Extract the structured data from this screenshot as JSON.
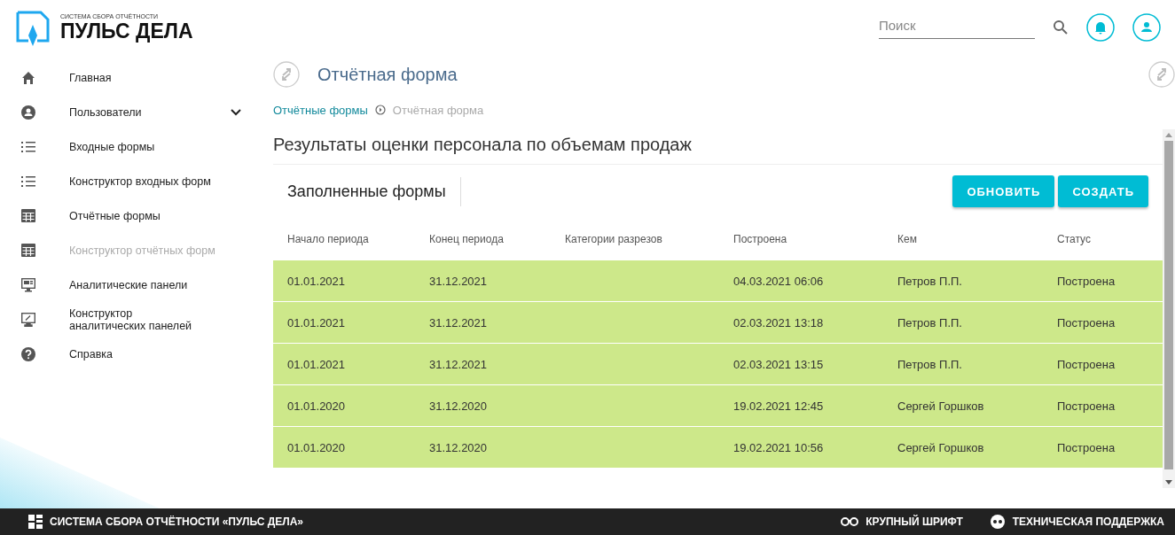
{
  "logo": {
    "subtitle": "СИСТЕМА СБОРА ОТЧЁТНОСТИ",
    "title": "ПУЛЬС ДЕЛА"
  },
  "search": {
    "placeholder": "Поиск"
  },
  "sidebar": {
    "items": [
      {
        "kind": "home",
        "label": "Главная",
        "disabled": false
      },
      {
        "kind": "user",
        "label": "Пользователи",
        "disabled": false,
        "expanded": false
      },
      {
        "kind": "list",
        "label": "Входные формы",
        "disabled": false
      },
      {
        "kind": "list",
        "label": "Конструктор входных форм",
        "disabled": false
      },
      {
        "kind": "table",
        "label": "Отчётные формы",
        "disabled": false
      },
      {
        "kind": "table",
        "label": "Конструктор отчётных форм",
        "disabled": true
      },
      {
        "kind": "monitor",
        "label": "Аналитические панели",
        "disabled": false
      },
      {
        "kind": "monitor-edit",
        "label": "Конструктор\nаналитических панелей",
        "disabled": false
      },
      {
        "kind": "help",
        "label": "Справка",
        "disabled": false
      }
    ]
  },
  "page_title": "Отчётная форма",
  "breadcrumbs": [
    "Отчётные формы",
    "Отчётная форма"
  ],
  "report_title": "Результаты оценки персонала по объемам продаж",
  "section_title": "Заполненные формы",
  "buttons": [
    "ОБНОВИТЬ",
    "СОЗДАТЬ"
  ],
  "table": {
    "columns": [
      "Начало периода",
      "Конец периода",
      "Категории разрезов",
      "Построена",
      "Кем",
      "Статус"
    ],
    "rows": [
      {
        "color": "#cde88a",
        "cells": [
          "01.01.2021",
          "31.12.2021",
          "",
          "04.03.2021 06:06",
          "Петров П.П.",
          "Построена"
        ]
      },
      {
        "color": "#cde88a",
        "cells": [
          "01.01.2021",
          "31.12.2021",
          "",
          "02.03.2021 13:18",
          "Петров П.П.",
          "Построена"
        ]
      },
      {
        "color": "#cde88a",
        "cells": [
          "01.01.2021",
          "31.12.2021",
          "",
          "02.03.2021 13:15",
          "Петров П.П.",
          "Построена"
        ]
      },
      {
        "color": "#cde88a",
        "cells": [
          "01.01.2020",
          "31.12.2020",
          "",
          "19.02.2021 12:45",
          "Сергей Горшков",
          "Построена"
        ]
      },
      {
        "color": "#cde88a",
        "cells": [
          "01.01.2020",
          "31.12.2020",
          "",
          "19.02.2021 10:56",
          "Сергей Горшков",
          "Построена"
        ]
      }
    ]
  },
  "footer": {
    "title": "СИСТЕМА СБОРА ОТЧЁТНОСТИ «ПУЛЬС ДЕЛА»",
    "links": [
      "КРУПНЫЙ ШРИФТ",
      "ТЕХНИЧЕСКАЯ ПОДДЕРЖКА"
    ]
  }
}
